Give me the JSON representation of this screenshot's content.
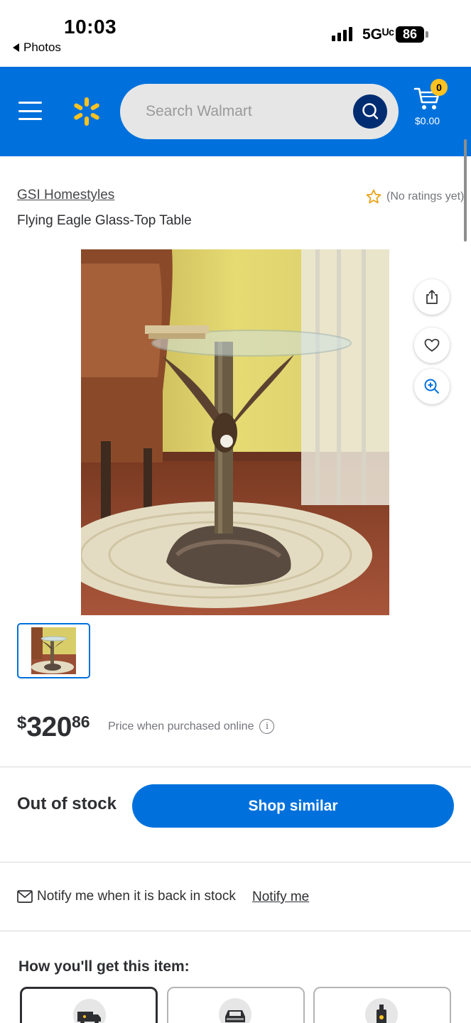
{
  "status_bar": {
    "time": "10:03",
    "back_label": "Photos",
    "network": "5Gᵁᶜ",
    "battery": "86"
  },
  "header": {
    "search_placeholder": "Search Walmart",
    "cart_count": "0",
    "cart_total": "$0.00",
    "brand_color": "#0071dc",
    "accent_color": "#ffc220"
  },
  "product": {
    "brand": "GSI Homestyles",
    "rating_text": "(No ratings yet)",
    "title": "Flying Eagle Glass-Top Table",
    "icons": [
      "share-icon",
      "heart-icon",
      "zoom-in-icon",
      "star-outline-icon"
    ]
  },
  "price": {
    "currency": "$",
    "dollars": "320",
    "cents": "86",
    "note": "Price when purchased online",
    "info_symbol": "i"
  },
  "stock": {
    "status": "Out of stock",
    "button_label": "Shop similar"
  },
  "notify": {
    "message": "Notify me when it is back in stock",
    "link": "Notify me"
  },
  "fulfillment": {
    "heading": "How you'll get this item:",
    "options": [
      "shipping-truck-icon",
      "pickup-car-icon",
      "delivery-bag-icon"
    ]
  }
}
